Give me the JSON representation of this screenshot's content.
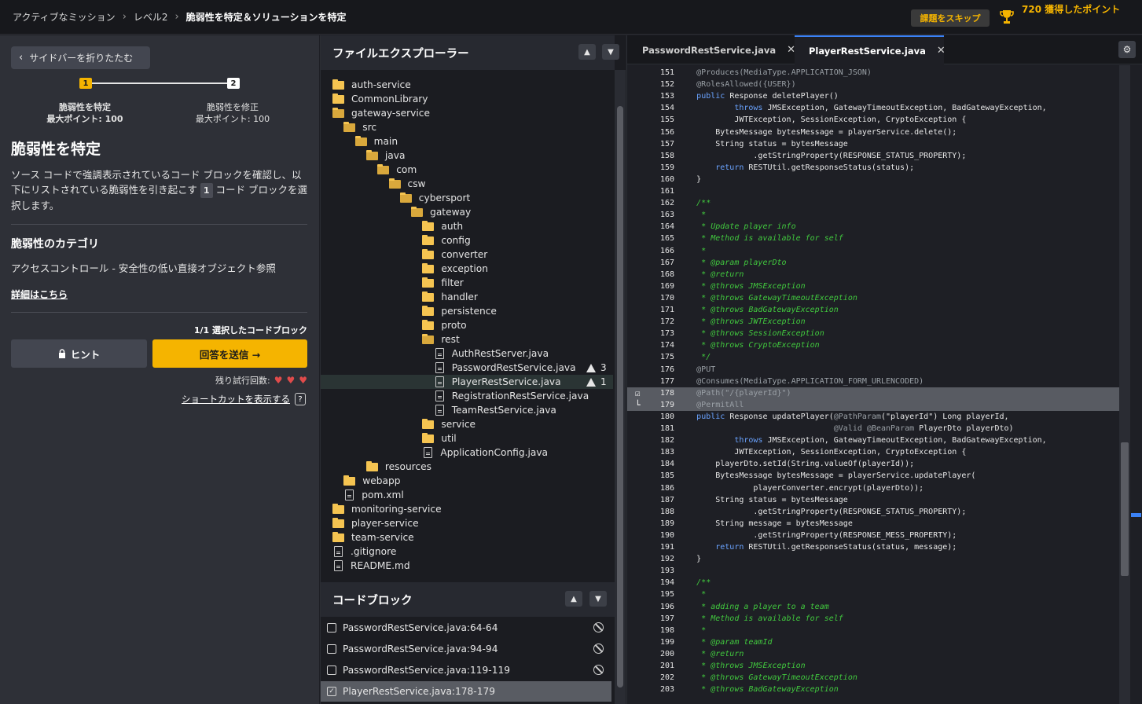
{
  "topbar": {
    "breadcrumbs": [
      "アクティブなミッション",
      "レベル2"
    ],
    "current": "脆弱性を特定＆ソリューションを特定",
    "skip_label": "課題をスキップ",
    "points_label": "720 獲得したポイント"
  },
  "sidebar": {
    "collapse_label": "サイドバーを折りたたむ",
    "steps": [
      {
        "num": "1",
        "title": "脆弱性を特定",
        "max": "最大ポイント: 100"
      },
      {
        "num": "2",
        "title": "脆弱性を修正",
        "max": "最大ポイント: 100"
      }
    ],
    "heading": "脆弱性を特定",
    "desc_part1": "ソース コードで強調表示されているコード ブロックを確認し、以下にリストされている脆弱性を引き起こす",
    "desc_count": "1",
    "desc_part2": "コード ブロックを選択します。",
    "category_heading": "脆弱性のカテゴリ",
    "category": "アクセスコントロール - 安全性の低い直接オブジェクト参照",
    "details_link": "詳細はこちら",
    "selected_count": "1/1 選択したコードブロック",
    "hint_label": "ヒント",
    "submit_label": "回答を送信 →",
    "tries_label": "残り試行回数:",
    "shortcuts_label": "ショートカットを表示する",
    "shortcuts_icon": "?"
  },
  "explorer": {
    "title": "ファイルエクスプローラー",
    "tree": [
      {
        "name": "auth-service",
        "type": "folder",
        "depth": 0
      },
      {
        "name": "CommonLibrary",
        "type": "folder",
        "depth": 0
      },
      {
        "name": "gateway-service",
        "type": "folder-open",
        "depth": 0
      },
      {
        "name": "src",
        "type": "folder-open",
        "depth": 1
      },
      {
        "name": "main",
        "type": "folder-open",
        "depth": 2
      },
      {
        "name": "java",
        "type": "folder-open",
        "depth": 3
      },
      {
        "name": "com",
        "type": "folder-open",
        "depth": 4
      },
      {
        "name": "csw",
        "type": "folder-open",
        "depth": 5
      },
      {
        "name": "cybersport",
        "type": "folder-open",
        "depth": 6
      },
      {
        "name": "gateway",
        "type": "folder-open",
        "depth": 7
      },
      {
        "name": "auth",
        "type": "folder",
        "depth": 8
      },
      {
        "name": "config",
        "type": "folder",
        "depth": 8
      },
      {
        "name": "converter",
        "type": "folder",
        "depth": 8
      },
      {
        "name": "exception",
        "type": "folder",
        "depth": 8
      },
      {
        "name": "filter",
        "type": "folder",
        "depth": 8
      },
      {
        "name": "handler",
        "type": "folder",
        "depth": 8
      },
      {
        "name": "persistence",
        "type": "folder",
        "depth": 8
      },
      {
        "name": "proto",
        "type": "folder",
        "depth": 8
      },
      {
        "name": "rest",
        "type": "folder-open",
        "depth": 8
      },
      {
        "name": "AuthRestServer.java",
        "type": "file",
        "depth": 9
      },
      {
        "name": "PasswordRestService.java",
        "type": "file",
        "depth": 9,
        "warn": "3"
      },
      {
        "name": "PlayerRestService.java",
        "type": "file",
        "depth": 9,
        "warn": "1",
        "selected": true
      },
      {
        "name": "RegistrationRestService.java",
        "type": "file",
        "depth": 9
      },
      {
        "name": "TeamRestService.java",
        "type": "file",
        "depth": 9
      },
      {
        "name": "service",
        "type": "folder",
        "depth": 8
      },
      {
        "name": "util",
        "type": "folder",
        "depth": 8
      },
      {
        "name": "ApplicationConfig.java",
        "type": "file",
        "depth": 8
      },
      {
        "name": "resources",
        "type": "folder",
        "depth": 3
      },
      {
        "name": "webapp",
        "type": "folder",
        "depth": 1
      },
      {
        "name": "pom.xml",
        "type": "file",
        "depth": 1
      },
      {
        "name": "monitoring-service",
        "type": "folder",
        "depth": 0
      },
      {
        "name": "player-service",
        "type": "folder",
        "depth": 0
      },
      {
        "name": "team-service",
        "type": "folder",
        "depth": 0
      },
      {
        "name": ".gitignore",
        "type": "file",
        "depth": 0
      },
      {
        "name": "README.md",
        "type": "file",
        "depth": 0
      }
    ],
    "blocks_title": "コードブロック",
    "blocks": [
      {
        "label": "PasswordRestService.java:64-64",
        "checked": false
      },
      {
        "label": "PasswordRestService.java:94-94",
        "checked": false
      },
      {
        "label": "PasswordRestService.java:119-119",
        "checked": false
      },
      {
        "label": "PlayerRestService.java:178-179",
        "checked": true
      }
    ]
  },
  "editor": {
    "tabs": [
      {
        "label": "PasswordRestService.java",
        "active": false
      },
      {
        "label": "PlayerRestService.java",
        "active": true
      }
    ],
    "lines": [
      {
        "n": "151",
        "t": "        @Produces(MediaType.APPLICATION_JSON)",
        "s": "a"
      },
      {
        "n": "152",
        "t": "        @RolesAllowed({USER})",
        "s": "a"
      },
      {
        "n": "153",
        "t": "        public Response deletePlayer()",
        "s": "k"
      },
      {
        "n": "154",
        "t": "                throws JMSException, GatewayTimeoutException, BadGatewayException,",
        "s": "k"
      },
      {
        "n": "155",
        "t": "                JWTException, SessionException, CryptoException {",
        "s": ""
      },
      {
        "n": "156",
        "t": "            BytesMessage bytesMessage = playerService.delete();",
        "s": ""
      },
      {
        "n": "157",
        "t": "            String status = bytesMessage",
        "s": ""
      },
      {
        "n": "158",
        "t": "                    .getStringProperty(RESPONSE_STATUS_PROPERTY);",
        "s": ""
      },
      {
        "n": "159",
        "t": "            return RESTUtil.getResponseStatus(status);",
        "s": "k"
      },
      {
        "n": "160",
        "t": "        }",
        "s": ""
      },
      {
        "n": "161",
        "t": "",
        "s": ""
      },
      {
        "n": "162",
        "t": "        /**",
        "s": "c"
      },
      {
        "n": "163",
        "t": "         *",
        "s": "c"
      },
      {
        "n": "164",
        "t": "         * Update player info",
        "s": "c"
      },
      {
        "n": "165",
        "t": "         * Method is available for self",
        "s": "c"
      },
      {
        "n": "166",
        "t": "         *",
        "s": "c"
      },
      {
        "n": "167",
        "t": "         * @param playerDto",
        "s": "c"
      },
      {
        "n": "168",
        "t": "         * @return",
        "s": "c"
      },
      {
        "n": "169",
        "t": "         * @throws JMSException",
        "s": "c"
      },
      {
        "n": "170",
        "t": "         * @throws GatewayTimeoutException",
        "s": "c"
      },
      {
        "n": "171",
        "t": "         * @throws BadGatewayException",
        "s": "c"
      },
      {
        "n": "172",
        "t": "         * @throws JWTException",
        "s": "c"
      },
      {
        "n": "173",
        "t": "         * @throws SessionException",
        "s": "c"
      },
      {
        "n": "174",
        "t": "         * @throws CryptoException",
        "s": "c"
      },
      {
        "n": "175",
        "t": "         */",
        "s": "c"
      },
      {
        "n": "176",
        "t": "        @PUT",
        "s": "a"
      },
      {
        "n": "177",
        "t": "        @Consumes(MediaType.APPLICATION_FORM_URLENCODED)",
        "s": "a"
      },
      {
        "n": "178",
        "t": "        @Path(\"/{playerId}\")",
        "s": "a",
        "hl": true
      },
      {
        "n": "179",
        "t": "        @PermitAll",
        "s": "a",
        "hl": true
      },
      {
        "n": "180",
        "t": "        public Response updatePlayer(@PathParam(\"playerId\") Long playerId,",
        "s": "k"
      },
      {
        "n": "181",
        "t": "                                     @Valid @BeanParam PlayerDto playerDto)",
        "s": ""
      },
      {
        "n": "182",
        "t": "                throws JMSException, GatewayTimeoutException, BadGatewayException,",
        "s": "k"
      },
      {
        "n": "183",
        "t": "                JWTException, SessionException, CryptoException {",
        "s": ""
      },
      {
        "n": "184",
        "t": "            playerDto.setId(String.valueOf(playerId));",
        "s": ""
      },
      {
        "n": "185",
        "t": "            BytesMessage bytesMessage = playerService.updatePlayer(",
        "s": ""
      },
      {
        "n": "186",
        "t": "                    playerConverter.encrypt(playerDto));",
        "s": ""
      },
      {
        "n": "187",
        "t": "            String status = bytesMessage",
        "s": ""
      },
      {
        "n": "188",
        "t": "                    .getStringProperty(RESPONSE_STATUS_PROPERTY);",
        "s": ""
      },
      {
        "n": "189",
        "t": "            String message = bytesMessage",
        "s": ""
      },
      {
        "n": "190",
        "t": "                    .getStringProperty(RESPONSE_MESS_PROPERTY);",
        "s": ""
      },
      {
        "n": "191",
        "t": "            return RESTUtil.getResponseStatus(status, message);",
        "s": "k"
      },
      {
        "n": "192",
        "t": "        }",
        "s": ""
      },
      {
        "n": "193",
        "t": "",
        "s": ""
      },
      {
        "n": "194",
        "t": "        /**",
        "s": "c"
      },
      {
        "n": "195",
        "t": "         *",
        "s": "c"
      },
      {
        "n": "196",
        "t": "         * adding a player to a team",
        "s": "c"
      },
      {
        "n": "197",
        "t": "         * Method is available for self",
        "s": "c"
      },
      {
        "n": "198",
        "t": "         *",
        "s": "c"
      },
      {
        "n": "199",
        "t": "         * @param teamId",
        "s": "c"
      },
      {
        "n": "200",
        "t": "         * @return",
        "s": "c"
      },
      {
        "n": "201",
        "t": "         * @throws JMSException",
        "s": "c"
      },
      {
        "n": "202",
        "t": "         * @throws GatewayTimeoutException",
        "s": "c"
      },
      {
        "n": "203",
        "t": "         * @throws BadGatewayException",
        "s": "c"
      }
    ]
  },
  "colors": {
    "accent": "#f5b400",
    "keyword": "#6aa3ff",
    "comment": "#41c93e",
    "heart": "#e04b4b",
    "tab_active": "#3b82f6"
  }
}
